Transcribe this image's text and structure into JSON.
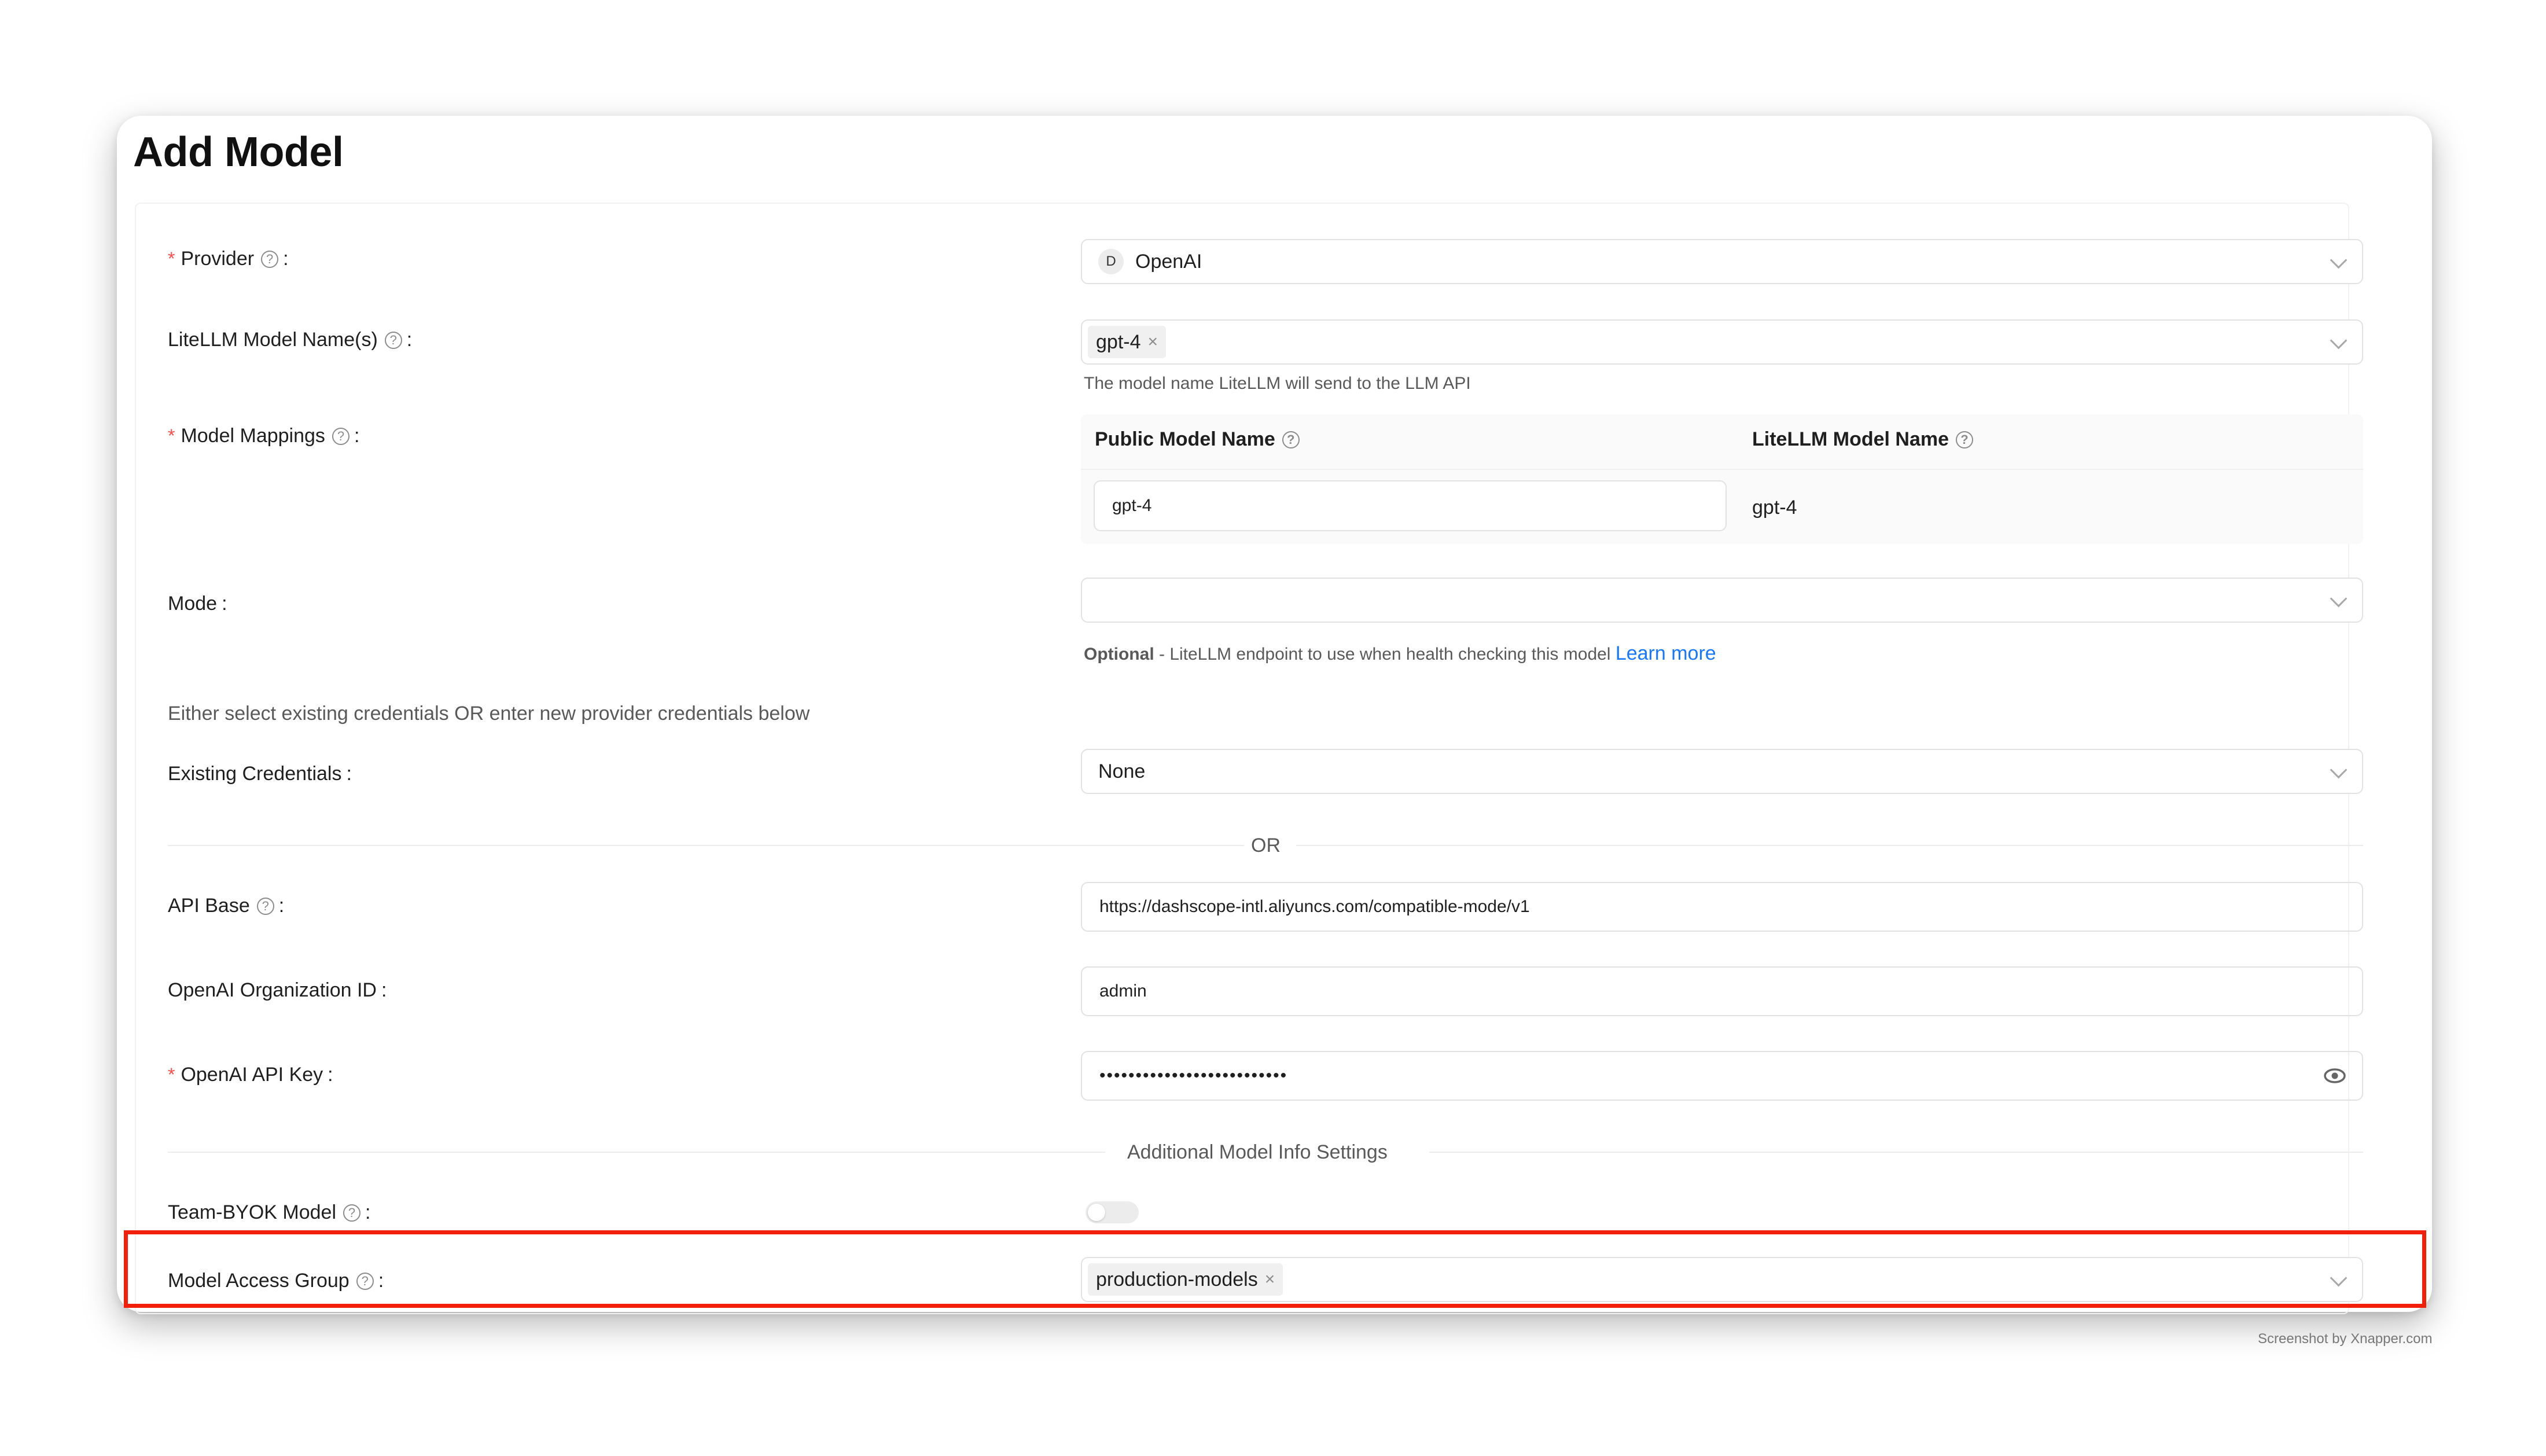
{
  "page_title": "Add Model",
  "provider": {
    "label": "Provider",
    "initial": "D",
    "value": "OpenAI"
  },
  "model_names": {
    "label": "LiteLLM Model Name(s)",
    "tag": "gpt-4",
    "help": "The model name LiteLLM will send to the LLM API"
  },
  "mappings": {
    "label": "Model Mappings",
    "col_public": "Public Model Name",
    "col_litellm": "LiteLLM Model Name",
    "public_value": "gpt-4",
    "litellm_value": "gpt-4"
  },
  "mode": {
    "label": "Mode",
    "value": "",
    "help_bold": "Optional",
    "help_text": " - LiteLLM endpoint to use when health checking this model ",
    "learn_more": "Learn more"
  },
  "credentials_note": "Either select existing credentials OR enter new provider credentials below",
  "existing_credentials": {
    "label": "Existing Credentials",
    "value": "None"
  },
  "or_text": "OR",
  "api_base": {
    "label": "API Base",
    "value": "https://dashscope-intl.aliyuncs.com/compatible-mode/v1"
  },
  "org_id": {
    "label": "OpenAI Organization ID",
    "value": "admin"
  },
  "api_key": {
    "label": "OpenAI API Key",
    "value": "••••••••••••••••••••••••••"
  },
  "additional_section": "Additional Model Info Settings",
  "team_byok": {
    "label": "Team-BYOK Model",
    "enabled": false
  },
  "access_group": {
    "label": "Model Access Group",
    "tag": "production-models"
  },
  "watermark": "Screenshot by Xnapper.com",
  "colors": {
    "required": "#ff4d4f",
    "link": "#1677ff",
    "highlight": "#f2200a"
  }
}
